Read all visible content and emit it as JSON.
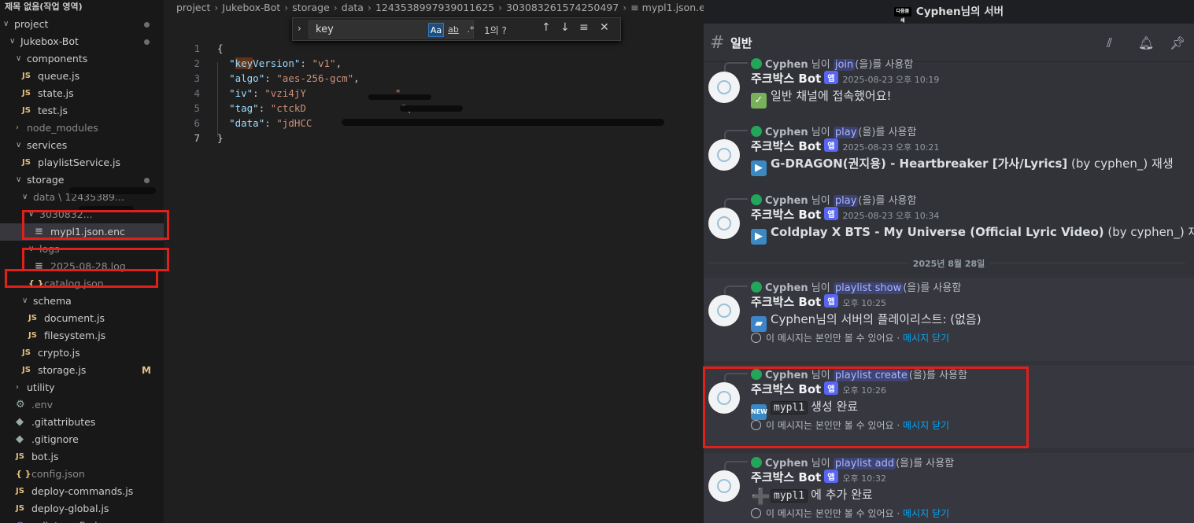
{
  "explorer": {
    "window_title": "제목 없음(작업 영역)",
    "items": [
      {
        "label": "project",
        "kind": "folder-open",
        "indent": 0,
        "dot": true
      },
      {
        "label": "Jukebox-Bot",
        "kind": "folder-open",
        "indent": 1,
        "dot": true
      },
      {
        "label": "components",
        "kind": "folder-open",
        "indent": 2
      },
      {
        "label": "queue.js",
        "kind": "js",
        "indent": 3
      },
      {
        "label": "state.js",
        "kind": "js",
        "indent": 3
      },
      {
        "label": "test.js",
        "kind": "js",
        "indent": 3
      },
      {
        "label": "node_modules",
        "kind": "folder-closed",
        "indent": 2,
        "dim": true
      },
      {
        "label": "services",
        "kind": "folder-open",
        "indent": 2
      },
      {
        "label": "playlistService.js",
        "kind": "js",
        "indent": 3
      },
      {
        "label": "storage",
        "kind": "folder-open",
        "indent": 2,
        "dot": true
      },
      {
        "label": "data \\ 12435389...",
        "kind": "folder-open",
        "indent": 3,
        "dim": true,
        "redacted": true
      },
      {
        "label": "3030832...",
        "kind": "folder-open",
        "indent": 4,
        "dim": true,
        "redacted": true
      },
      {
        "label": "mypl1.json.enc",
        "kind": "file",
        "indent": 5,
        "selected": true
      },
      {
        "label": "logs",
        "kind": "folder-open",
        "indent": 4,
        "dim": true
      },
      {
        "label": "2025-08-28.log",
        "kind": "file",
        "indent": 5,
        "dim": true
      },
      {
        "label": "catalog.json",
        "kind": "json",
        "indent": 4,
        "dim": true
      },
      {
        "label": "schema",
        "kind": "folder-open",
        "indent": 3
      },
      {
        "label": "document.js",
        "kind": "js",
        "indent": 4
      },
      {
        "label": "filesystem.js",
        "kind": "js",
        "indent": 4
      },
      {
        "label": "crypto.js",
        "kind": "js",
        "indent": 3
      },
      {
        "label": "storage.js",
        "kind": "js",
        "indent": 3,
        "badge": "M"
      },
      {
        "label": "utility",
        "kind": "folder-closed",
        "indent": 2
      },
      {
        "label": ".env",
        "kind": "gear",
        "indent": 2,
        "dim": true
      },
      {
        "label": ".gitattributes",
        "kind": "git",
        "indent": 2
      },
      {
        "label": ".gitignore",
        "kind": "git",
        "indent": 2
      },
      {
        "label": "bot.js",
        "kind": "js",
        "indent": 2
      },
      {
        "label": "config.json",
        "kind": "json",
        "indent": 2,
        "dim": true
      },
      {
        "label": "deploy-commands.js",
        "kind": "js",
        "indent": 2
      },
      {
        "label": "deploy-global.js",
        "kind": "js",
        "indent": 2
      },
      {
        "label": "eslint.config.js",
        "kind": "esl",
        "indent": 2
      }
    ]
  },
  "editor": {
    "breadcrumb": [
      "project",
      "Jukebox-Bot",
      "storage",
      "data",
      "1243538997939011625",
      "303083261574250497",
      "mypl1.json.enc"
    ],
    "find": {
      "query": "key",
      "count": "1의 ?",
      "case_label": "Aa",
      "word_label": "ab",
      "regex_label": ".*"
    },
    "lines": [
      {
        "n": "1",
        "parts": [
          [
            "p",
            "{"
          ]
        ]
      },
      {
        "n": "2",
        "parts": [
          [
            "p",
            "  "
          ],
          [
            "kh",
            "\"key"
          ],
          [
            "k",
            "Version\""
          ],
          [
            "p",
            ": "
          ],
          [
            "s",
            "\"v1\""
          ],
          [
            "p",
            ","
          ]
        ]
      },
      {
        "n": "3",
        "parts": [
          [
            "p",
            "  "
          ],
          [
            "k",
            "\"algo\""
          ],
          [
            "p",
            ": "
          ],
          [
            "s",
            "\"aes-256-gcm\""
          ],
          [
            "p",
            ","
          ]
        ]
      },
      {
        "n": "4",
        "parts": [
          [
            "p",
            "  "
          ],
          [
            "k",
            "\"iv\""
          ],
          [
            "p",
            ": "
          ],
          [
            "s",
            "\"vzi4jY"
          ],
          [
            "p",
            "               "
          ],
          [
            "s",
            "\""
          ],
          [
            "p",
            ","
          ]
        ]
      },
      {
        "n": "5",
        "parts": [
          [
            "p",
            "  "
          ],
          [
            "k",
            "\"tag\""
          ],
          [
            "p",
            ": "
          ],
          [
            "s",
            "\"ctckD"
          ],
          [
            "p",
            "                "
          ],
          [
            "s",
            "\""
          ],
          [
            "p",
            ","
          ]
        ]
      },
      {
        "n": "6",
        "parts": [
          [
            "p",
            "  "
          ],
          [
            "k",
            "\"data\""
          ],
          [
            "p",
            ": "
          ],
          [
            "s",
            "\"jdHCC"
          ]
        ]
      },
      {
        "n": "7",
        "parts": [
          [
            "p",
            "}"
          ]
        ]
      }
    ]
  },
  "discord": {
    "server_title": "Cyphen님의 서버",
    "server_icon_text": "다음봄쇄",
    "channel": "일반",
    "date_divider": "2025년 8월 28일",
    "messages": [
      {
        "reply_user": "Cyphen",
        "reply_mid": "님이",
        "reply_cmd": "join",
        "reply_tail": "(을)를 사용함",
        "bot": "주크박스 Bot",
        "app": "앱",
        "time": "2025-08-23 오후 10:19",
        "emoji": "chk",
        "emoji_text": "✓",
        "text": "일반 채널에 접속했어요!",
        "code": "",
        "bold": "",
        "tail": "",
        "note": ""
      },
      {
        "reply_user": "Cyphen",
        "reply_mid": "님이",
        "reply_cmd": "play",
        "reply_tail": "(을)를 사용함",
        "bot": "주크박스 Bot",
        "app": "앱",
        "time": "2025-08-23 오후 10:21",
        "emoji": "play",
        "emoji_text": "▶",
        "bold": "G-DRAGON(권지용) - Heartbreaker [가사/Lyrics]",
        "text": "",
        "tail": " (by cyphen_) 재생",
        "code": "",
        "note": ""
      },
      {
        "reply_user": "Cyphen",
        "reply_mid": "님이",
        "reply_cmd": "play",
        "reply_tail": "(을)를 사용함",
        "bot": "주크박스 Bot",
        "app": "앱",
        "time": "2025-08-23 오후 10:34",
        "emoji": "play",
        "emoji_text": "▶",
        "bold": "Coldplay X BTS - My Universe (Official Lyric Video)",
        "text": "",
        "tail": " (by cyphen_) 재생",
        "code": "",
        "note": ""
      },
      {
        "reply_user": "Cyphen",
        "reply_mid": "님이",
        "reply_cmd": "playlist show",
        "reply_tail": "(을)를 사용함",
        "bot": "주크박스 Bot",
        "app": "앱",
        "time": "오후 10:25",
        "emoji": "fold",
        "emoji_text": "▰",
        "text": "Cyphen님의 서버의 플레이리스트: (없음)",
        "code": "",
        "bold": "",
        "tail": "",
        "note": "이 메시지는 본인만 볼 수 있어요 · ",
        "note_link": "메시지 닫기"
      },
      {
        "reply_user": "Cyphen",
        "reply_mid": "님이",
        "reply_cmd": "playlist create",
        "reply_tail": "(을)를 사용함",
        "bot": "주크박스 Bot",
        "app": "앱",
        "time": "오후 10:26",
        "emoji": "new",
        "emoji_text": "NEW",
        "code": "mypl1",
        "text": "생성 완료",
        "bold": "",
        "tail": "",
        "note": "이 메시지는 본인만 볼 수 있어요 · ",
        "note_link": "메시지 닫기"
      },
      {
        "reply_user": "Cyphen",
        "reply_mid": "님이",
        "reply_cmd": "playlist add",
        "reply_tail": "(을)를 사용함",
        "bot": "주크박스 Bot",
        "app": "앱",
        "time": "오후 10:32",
        "emoji": "plus",
        "emoji_text": "➕",
        "code": "mypl1",
        "text": "에 추가 완료",
        "bold": "",
        "tail": "",
        "note": "이 메시지는 본인만 볼 수 있어요 · ",
        "note_link": "메시지 닫기"
      }
    ]
  },
  "colors": {
    "accent": "#5865f2",
    "annotation": "#e0201a",
    "link": "#00a8fc"
  }
}
